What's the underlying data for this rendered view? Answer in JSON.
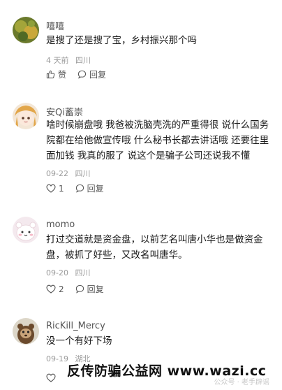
{
  "comments": [
    {
      "username": "嘻嘻",
      "text": "是搜了还是搜了宝，乡村振兴那个吗",
      "time": "4 天前",
      "location": "四川",
      "like_label": "赞",
      "reply_label": "回复"
    },
    {
      "username": "安Qi蓄崇",
      "text": "啥时候崩盘哦 我爸被洗脑壳洗的严重得很 说什么国务院都在给他做宣传哦 什么秘书长都去讲话哦 还要往里面加钱 我真的服了 说这个是骗子公司还说我不懂",
      "time": "09-22",
      "location": "四川",
      "like_label": "1",
      "reply_label": "回复"
    },
    {
      "username": "momo",
      "text": "打过交道就是资金盘，以前艺名叫唐小华也是做资金盘，被抓了好些，又改名叫唐华。",
      "time": "09-20",
      "location": "四川",
      "like_label": "2",
      "reply_label": "回复"
    },
    {
      "username": "RicKill_Mercy",
      "text": "没一个有好下场",
      "time": "09-19",
      "location": "湖北",
      "like_label": "",
      "reply_label": ""
    }
  ],
  "watermark": "反传防骗公益网 www.wazi.cc",
  "faint_watermark": "公众号 · 老手辟谣"
}
